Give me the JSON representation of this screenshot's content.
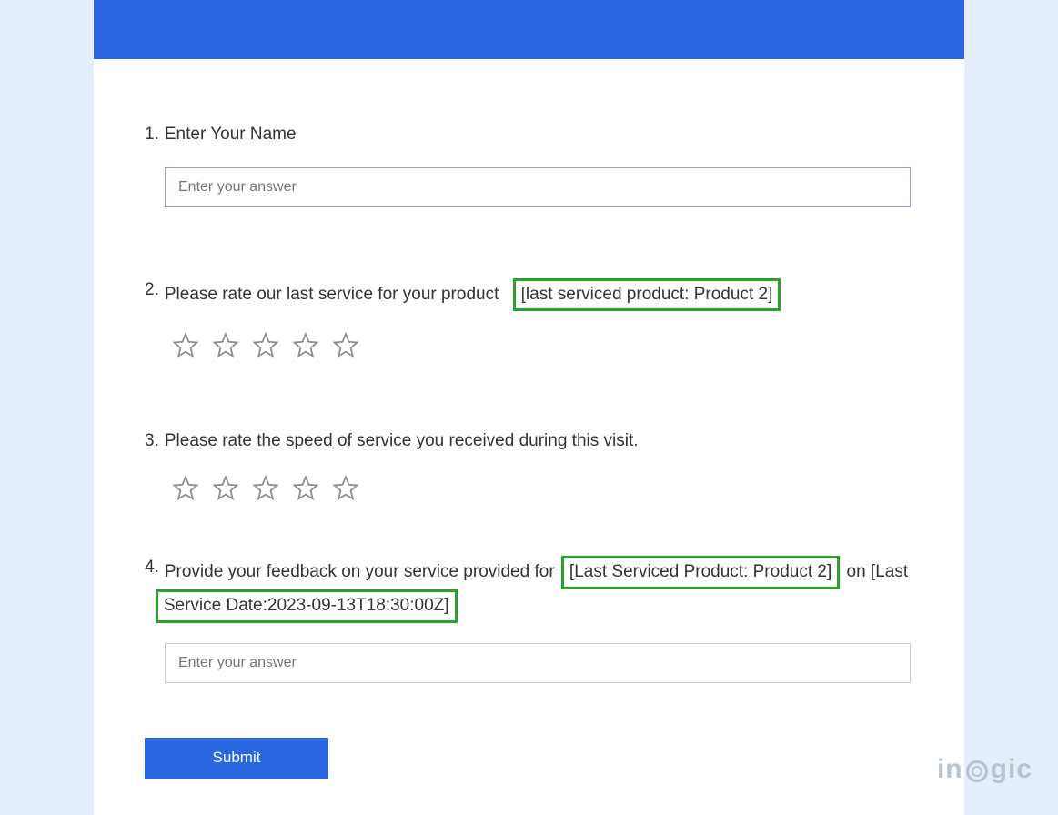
{
  "form": {
    "questions": [
      {
        "number": "1.",
        "text": "Enter Your Name",
        "placeholder": "Enter your answer"
      },
      {
        "number": "2.",
        "text_prefix": "Please rate our last service for your product",
        "highlight": "[last serviced product: Product 2]"
      },
      {
        "number": "3.",
        "text": "Please rate the speed of service you received during this visit."
      },
      {
        "number": "4.",
        "text_prefix": "Provide your feedback on your service provided for",
        "highlight1": "[Last Serviced Product: Product 2]",
        "text_middle": "on [Last",
        "highlight2": "Service Date:2023-09-13T18:30:00Z]",
        "placeholder": "Enter your answer"
      }
    ],
    "submit_label": "Submit"
  },
  "watermark": {
    "part1": "in",
    "part2": "gic"
  }
}
